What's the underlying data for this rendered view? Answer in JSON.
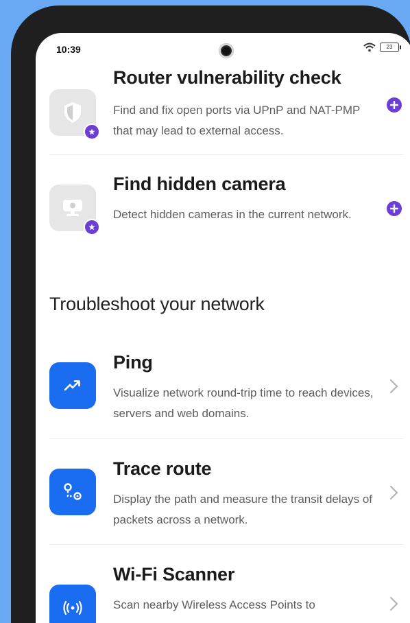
{
  "status_bar": {
    "time": "10:39",
    "battery": "23"
  },
  "security_items": [
    {
      "title": "Router vulnerability check",
      "description": "Find and fix open ports via UPnP and NAT-PMP that may lead to external access.",
      "tile_icon": "shield-icon",
      "action_icon": "plus-icon"
    },
    {
      "title": "Find hidden camera",
      "description": "Detect hidden cameras in the current network.",
      "tile_icon": "webcam-icon",
      "action_icon": "plus-icon"
    }
  ],
  "section": {
    "heading": "Troubleshoot your network"
  },
  "troubleshoot_items": [
    {
      "title": "Ping",
      "description": "Visualize network round-trip time to reach devices, servers and web domains.",
      "tile_icon": "trend-icon"
    },
    {
      "title": "Trace route",
      "description": "Display the path and measure the transit delays of packets across a network.",
      "tile_icon": "route-pin-icon"
    },
    {
      "title": "Wi-Fi Scanner",
      "description": "Scan nearby Wireless Access Points to",
      "tile_icon": "wifi-broadcast-icon"
    }
  ],
  "colors": {
    "primary_blue": "#1a6cf0",
    "premium_purple": "#6b3fd6",
    "background_outer": "#6aa9f4"
  }
}
